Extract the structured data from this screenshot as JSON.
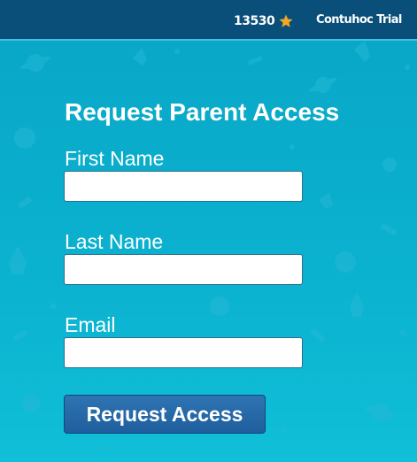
{
  "header": {
    "points": "13530",
    "points_icon": "star-icon",
    "account_name": "Contuhoc Trial"
  },
  "form": {
    "title": "Request Parent Access",
    "fields": [
      {
        "label": "First Name",
        "value": ""
      },
      {
        "label": "Last Name",
        "value": ""
      },
      {
        "label": "Email",
        "value": ""
      }
    ],
    "submit_label": "Request Access"
  },
  "colors": {
    "header_bg": "#0a4f7a",
    "page_bg": "#0aa6c6",
    "button_bg": "#2a6aa8",
    "star": "#f5a623"
  }
}
